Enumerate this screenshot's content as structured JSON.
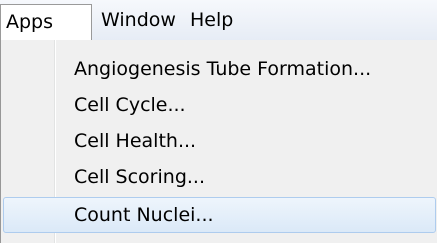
{
  "menubar": {
    "items": [
      {
        "label": "Apps",
        "active": true
      },
      {
        "label": "Window",
        "active": false
      },
      {
        "label": "Help",
        "active": false
      }
    ]
  },
  "apps_menu": {
    "items": [
      {
        "label": "Angiogenesis Tube Formation...",
        "highlighted": false
      },
      {
        "label": "Cell Cycle...",
        "highlighted": false
      },
      {
        "label": "Cell Health...",
        "highlighted": false
      },
      {
        "label": "Cell Scoring...",
        "highlighted": false
      },
      {
        "label": "Count Nuclei...",
        "highlighted": true
      }
    ]
  },
  "colors": {
    "menu_background": "#f0f0f0",
    "highlight_border": "#aeccee",
    "highlight_fill": "#dbe9f8",
    "menubar_background": "#e6ecf5"
  }
}
